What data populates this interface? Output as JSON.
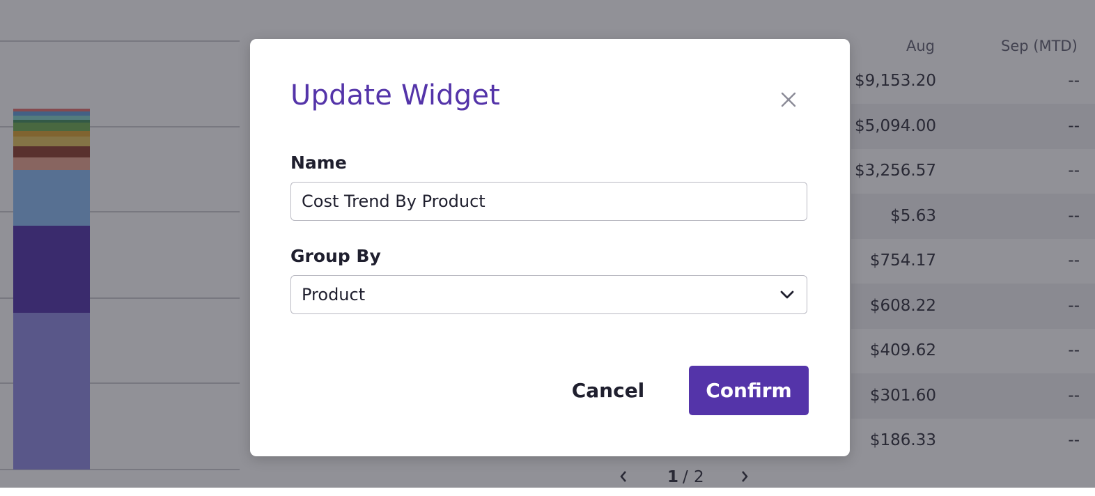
{
  "background": {
    "table": {
      "columns": [
        "Aug",
        "Sep (MTD)"
      ],
      "rows": [
        {
          "aug": "$9,153.20",
          "sep": "--"
        },
        {
          "aug": "$5,094.00",
          "sep": "--"
        },
        {
          "aug": "$3,256.57",
          "sep": "--"
        },
        {
          "aug": "$5.63",
          "sep": "--"
        },
        {
          "aug": "$754.17",
          "sep": "--"
        },
        {
          "aug": "$608.22",
          "sep": "--"
        },
        {
          "aug": "$409.62",
          "sep": "--"
        },
        {
          "aug": "$301.60",
          "sep": "--"
        },
        {
          "aug": "$186.33",
          "sep": "--"
        }
      ]
    },
    "pagination": {
      "current": "1",
      "separator": "/",
      "total": "2"
    },
    "chart_segment_colors": [
      "#8a86e0",
      "#4d2fa8",
      "#86b8f2",
      "#e8a38e",
      "#8b3b2a",
      "#e0c15a",
      "#d8a02e",
      "#6aa84f",
      "#3f8a5a",
      "#7fd0c8",
      "#5f9bd8",
      "#e26d6d"
    ]
  },
  "modal": {
    "title": "Update Widget",
    "name_label": "Name",
    "name_value": "Cost Trend By Product",
    "group_by_label": "Group By",
    "group_by_value": "Product",
    "cancel_label": "Cancel",
    "confirm_label": "Confirm",
    "accent_color": "#5434a9"
  }
}
